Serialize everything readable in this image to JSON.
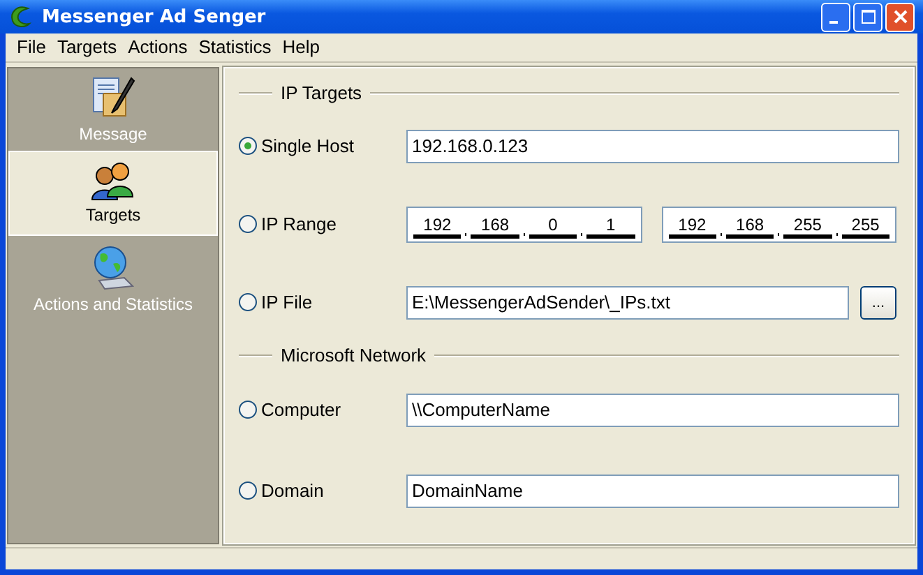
{
  "window": {
    "title": "Messenger Ad Senger"
  },
  "menu": [
    "File",
    "Targets",
    "Actions",
    "Statistics",
    "Help"
  ],
  "sidebar": {
    "items": [
      {
        "label": "Message",
        "selected": false
      },
      {
        "label": "Targets",
        "selected": true
      },
      {
        "label": "Actions and Statistics",
        "selected": false
      }
    ]
  },
  "sections": [
    {
      "title": "IP Targets",
      "rows": [
        {
          "kind": "text",
          "label": "Single Host",
          "selected": true,
          "value": "192.168.0.123"
        },
        {
          "kind": "iprange",
          "label": "IP Range",
          "selected": false,
          "ranges": [
            [
              "192",
              "168",
              "0",
              "1"
            ],
            [
              "192",
              "168",
              "255",
              "255"
            ]
          ]
        },
        {
          "kind": "file",
          "label": "IP File",
          "selected": false,
          "value": "E:\\MessengerAdSender\\_IPs.txt",
          "button": "..."
        }
      ]
    },
    {
      "title": "Microsoft Network",
      "rows": [
        {
          "kind": "text",
          "label": "Computer",
          "selected": false,
          "value": "\\\\ComputerName"
        },
        {
          "kind": "text",
          "label": "Domain",
          "selected": false,
          "value": "DomainName"
        }
      ]
    }
  ]
}
